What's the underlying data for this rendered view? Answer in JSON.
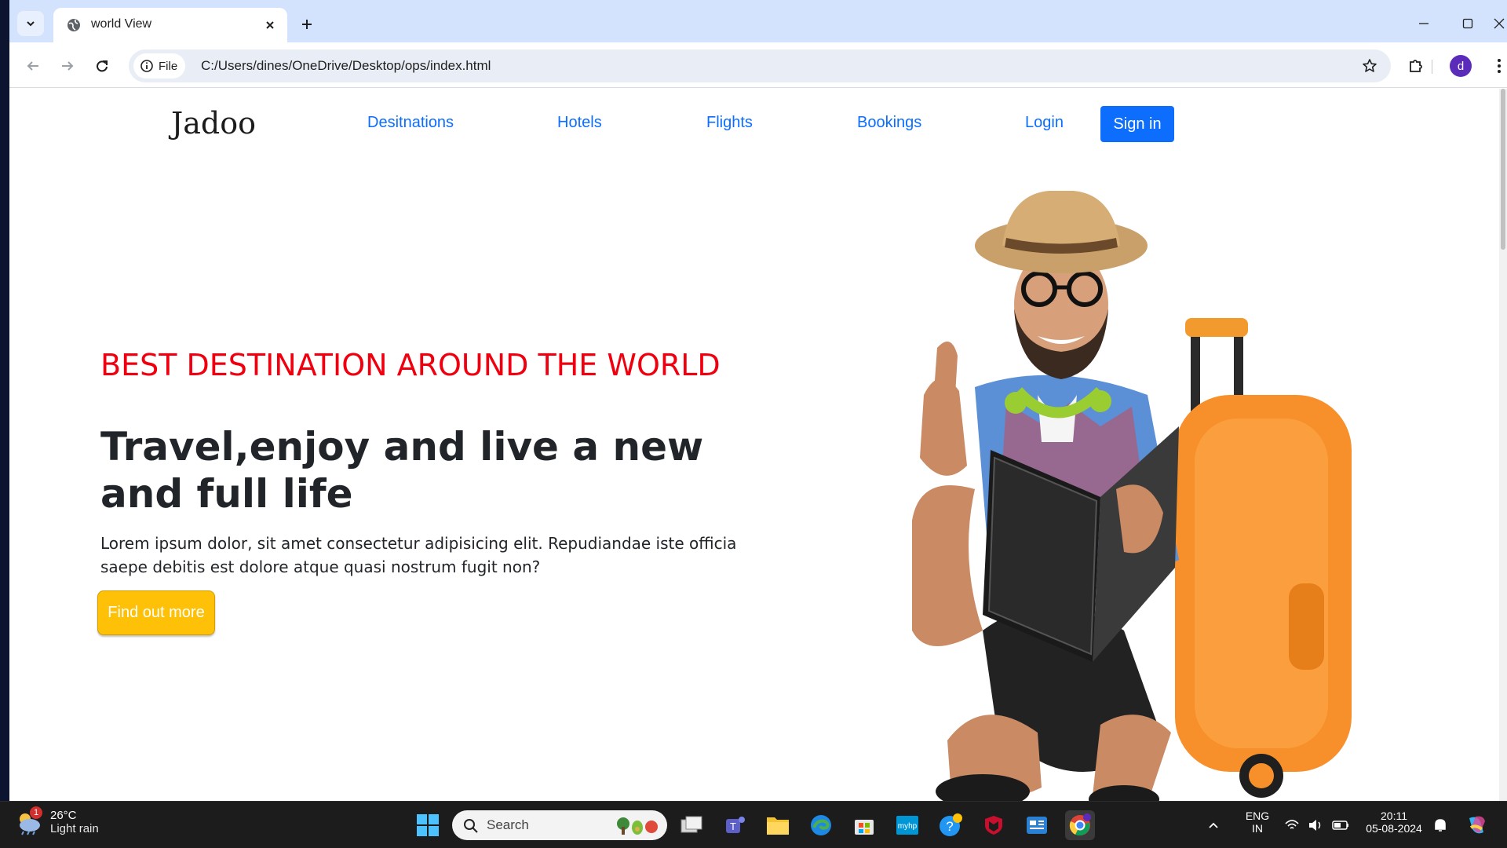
{
  "browser": {
    "tab_title": "world View",
    "address_chip": "File",
    "url": "C:/Users/dines/OneDrive/Desktop/ops/index.html",
    "profile_initial": "d"
  },
  "page": {
    "brand": "Jadoo",
    "nav": [
      "Desitnations",
      "Hotels",
      "Flights",
      "Bookings",
      "Login"
    ],
    "signin": "Sign in",
    "eyebrow": "BEST DESTINATION AROUND THE WORLD",
    "headline": "Travel,enjoy and live a new and full life",
    "lede": "Lorem ipsum dolor, sit amet consectetur adipisicing elit. Repudiandae iste officia saepe debitis est dolore atque quasi nostrum fugit non?",
    "cta": "Find out more",
    "colors": {
      "link": "#0d6efd",
      "eyebrow": "#f0000f",
      "cta": "#ffc107"
    }
  },
  "taskbar": {
    "weather_temp": "26°C",
    "weather_desc": "Light rain",
    "weather_badge": "1",
    "search_placeholder": "Search",
    "lang_line1": "ENG",
    "lang_line2": "IN",
    "time": "20:11",
    "date": "05-08-2024"
  }
}
